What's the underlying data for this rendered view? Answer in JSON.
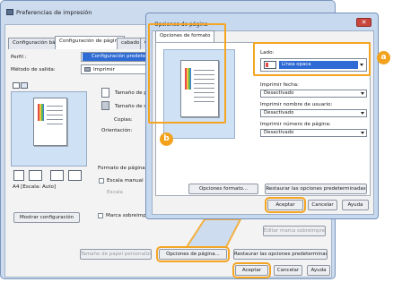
{
  "back_window": {
    "title": "Preferencias de impresión",
    "tabs": [
      "Configuración básic",
      "Configuración de página",
      "cabado",
      "Calid"
    ],
    "perfil_label": "Perfil :",
    "perfil_value": "Configuración predeter",
    "output_label": "Método de salida:",
    "output_value": "Imprimir",
    "tamano_1": "Tamaño de p",
    "tamano_2": "Tamaño de s",
    "copias_label": "Copias:",
    "orientacion_label": "Orientación:",
    "formato_label": "Formato de página:",
    "escala_manual_label": "Escala manual",
    "escala_label": "Escala",
    "preview_caption": "A4 [Escala: Auto]",
    "mostrar_config_button": "Mostrar configuración",
    "marca_label": "Marca sobreimpr",
    "editar_marca_button": "Editar marca sobreimpresión...",
    "papel_personalizado_button": "Tamaño de papel personalizado...",
    "opciones_pagina_button": "Opciones de página...",
    "restaurar_button": "Restaurar las opciones predeterminadas",
    "aceptar_button": "Aceptar",
    "cancelar_button": "Cancelar",
    "ayuda_button": "Ayuda"
  },
  "dialog": {
    "title": "Opciones de página",
    "close_glyph": "✕",
    "tab": "Opciones de formato",
    "lado_label": "Lado:",
    "lado_value": "Línea opaca",
    "fecha_label": "Imprimir fecha:",
    "fecha_value": "Desactivado",
    "usuario_label": "Imprimir nombre de usuario:",
    "usuario_value": "Desactivado",
    "numero_label": "Imprimir número de página:",
    "numero_value": "Desactivado",
    "opciones_formato_button": "Opciones formato...",
    "restaurar_button": "Restaurar las opciones predeterminadas",
    "aceptar_button": "Aceptar",
    "cancelar_button": "Cancelar",
    "ayuda_button": "Ayuda"
  },
  "callouts": {
    "a": "a",
    "b": "b"
  },
  "colors": {
    "highlight": "#f4a523",
    "callout": "#f2a21d",
    "selection": "#2f6bd4",
    "close": "#c9463d"
  }
}
